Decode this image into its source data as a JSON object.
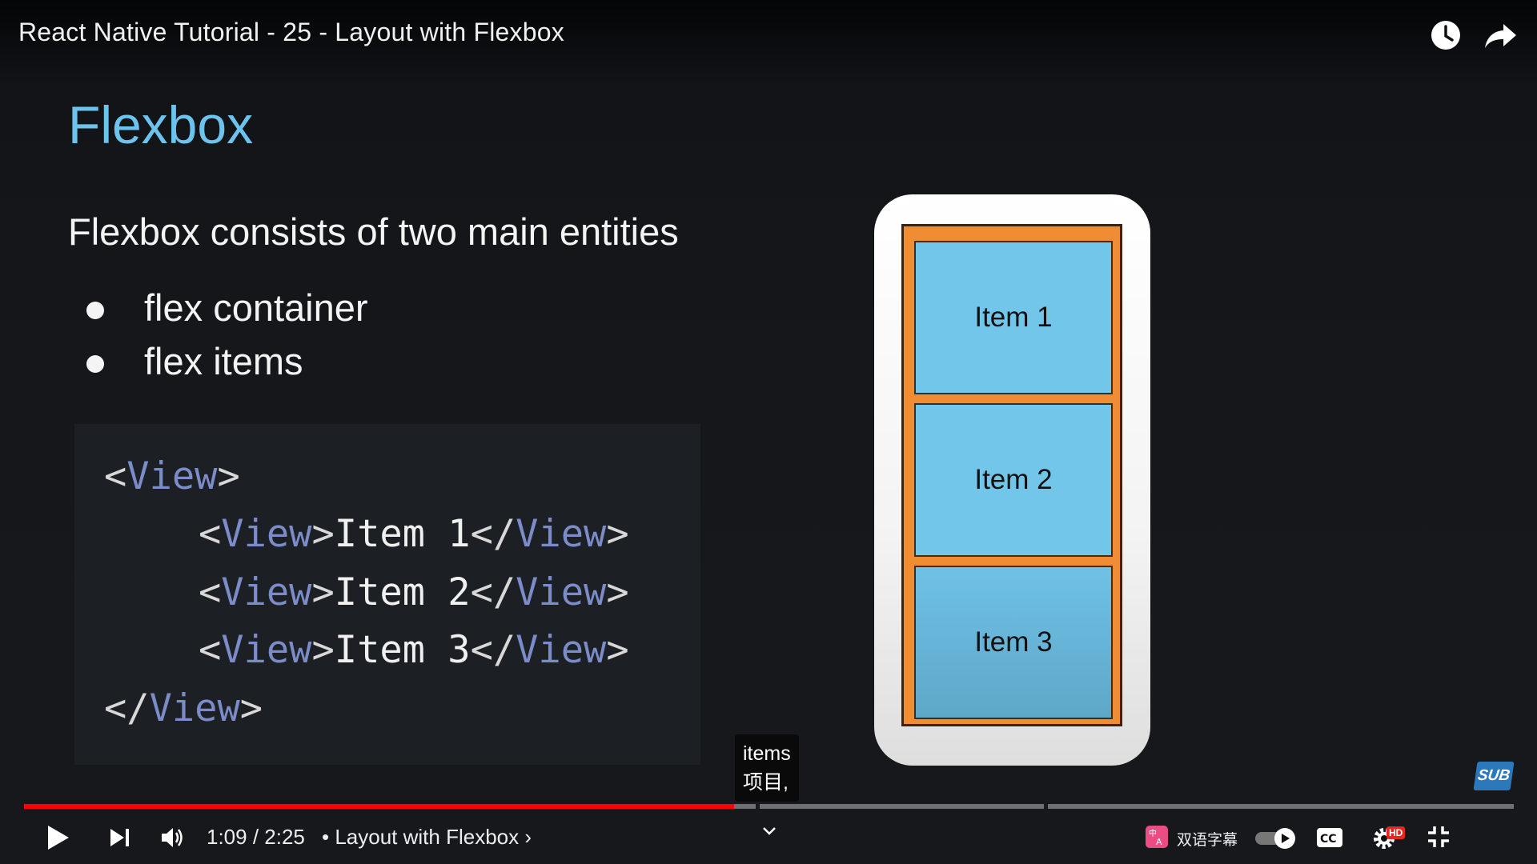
{
  "video": {
    "title": "React Native Tutorial - 25 - Layout with Flexbox"
  },
  "top_icons": {
    "watch_later": "clock-icon",
    "share": "share-arrow-icon"
  },
  "slide": {
    "heading": "Flexbox",
    "intro": "Flexbox consists of two main entities",
    "bullets": [
      "flex container",
      "flex items"
    ],
    "code": {
      "open_bracket": "<",
      "close_bracket": ">",
      "close_open": "</",
      "tag": "View",
      "item_prefix": "Item ",
      "items": [
        "1",
        "2",
        "3"
      ]
    },
    "diagram": {
      "items": [
        "Item 1",
        "Item 2",
        "Item 3"
      ],
      "colors": {
        "container": "#f08d32",
        "item": "#72c6ea"
      }
    }
  },
  "caption": {
    "line1": "items",
    "line2": "项目,"
  },
  "sub_badge": "SUB",
  "player": {
    "progress_fraction": 0.4765,
    "current_time": "1:09",
    "duration": "2:25",
    "time_display": "1:09 / 2:25",
    "separator": "•",
    "chapter": "Layout with Flexbox",
    "dual_subtitle_label": "双语字幕",
    "hd_badge": "HD",
    "accent_color": "#ff0000"
  }
}
